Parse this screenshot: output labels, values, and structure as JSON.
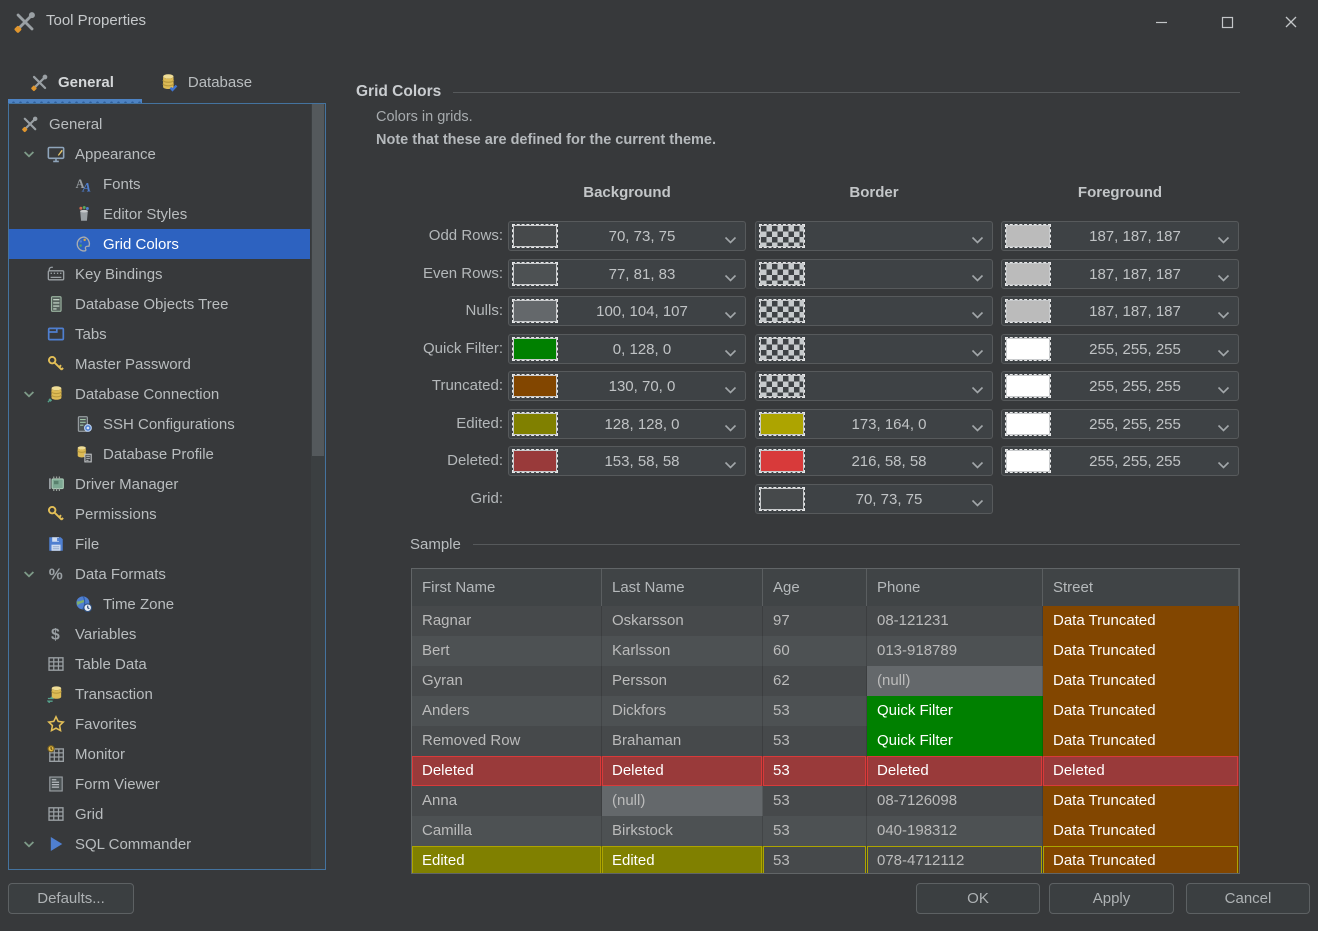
{
  "window": {
    "title": "Tool Properties",
    "controls": [
      {
        "name": "minimize-button",
        "icon": "minimize-icon"
      },
      {
        "name": "maximize-button",
        "icon": "maximize-icon"
      },
      {
        "name": "close-button",
        "icon": "close-icon"
      }
    ]
  },
  "tabs": [
    {
      "label": "General",
      "icon": "tools-icon",
      "selected": true
    },
    {
      "label": "Database",
      "icon": "database-check-icon",
      "selected": false
    }
  ],
  "sidebar": {
    "items": [
      {
        "label": "General",
        "icon": "tools-icon",
        "depth": 0
      },
      {
        "label": "Appearance",
        "icon": "appearance-icon",
        "depth": 1,
        "expanded": true
      },
      {
        "label": "Fonts",
        "icon": "fonts-icon",
        "depth": 2
      },
      {
        "label": "Editor Styles",
        "icon": "editor-styles-icon",
        "depth": 2
      },
      {
        "label": "Grid Colors",
        "icon": "grid-colors-icon",
        "depth": 2,
        "selected": true
      },
      {
        "label": "Key Bindings",
        "icon": "keyboard-icon",
        "depth": 1
      },
      {
        "label": "Database Objects Tree",
        "icon": "server-tree-icon",
        "depth": 1
      },
      {
        "label": "Tabs",
        "icon": "tabs-icon",
        "depth": 1
      },
      {
        "label": "Master Password",
        "icon": "key-icon",
        "depth": 1
      },
      {
        "label": "Database Connection",
        "icon": "database-connection-icon",
        "depth": 1,
        "expanded": true
      },
      {
        "label": "SSH Configurations",
        "icon": "ssh-icon",
        "depth": 2
      },
      {
        "label": "Database Profile",
        "icon": "database-profile-icon",
        "depth": 2
      },
      {
        "label": "Driver Manager",
        "icon": "driver-icon",
        "depth": 1
      },
      {
        "label": "Permissions",
        "icon": "key-icon",
        "depth": 1
      },
      {
        "label": "File",
        "icon": "floppy-icon",
        "depth": 1
      },
      {
        "label": "Data Formats",
        "icon": "percent-icon",
        "depth": 1,
        "expanded": true
      },
      {
        "label": "Time Zone",
        "icon": "timezone-icon",
        "depth": 2
      },
      {
        "label": "Variables",
        "icon": "dollar-icon",
        "depth": 1
      },
      {
        "label": "Table Data",
        "icon": "table-icon",
        "depth": 1
      },
      {
        "label": "Transaction",
        "icon": "transaction-icon",
        "depth": 1
      },
      {
        "label": "Favorites",
        "icon": "star-icon",
        "depth": 1
      },
      {
        "label": "Monitor",
        "icon": "monitor-icon",
        "depth": 1
      },
      {
        "label": "Form Viewer",
        "icon": "form-icon",
        "depth": 1
      },
      {
        "label": "Grid",
        "icon": "table-icon",
        "depth": 1
      },
      {
        "label": "SQL Commander",
        "icon": "play-icon",
        "depth": 1,
        "expanded": true
      }
    ]
  },
  "panel": {
    "title": "Grid Colors",
    "description": "Colors in grids.",
    "note": "Note that these are defined for the current theme.",
    "columns": [
      "Background",
      "Border",
      "Foreground"
    ],
    "rows": [
      {
        "label": "Odd Rows:",
        "background": {
          "color": "#46494B",
          "value": "70, 73, 75"
        },
        "border": {
          "transparent": true
        },
        "foreground": {
          "color": "#BBBBBB",
          "value": "187, 187, 187"
        }
      },
      {
        "label": "Even Rows:",
        "background": {
          "color": "#4D5153",
          "value": "77, 81, 83"
        },
        "border": {
          "transparent": true
        },
        "foreground": {
          "color": "#BBBBBB",
          "value": "187, 187, 187"
        }
      },
      {
        "label": "Nulls:",
        "background": {
          "color": "#64686B",
          "value": "100, 104, 107"
        },
        "border": {
          "transparent": true
        },
        "foreground": {
          "color": "#BBBBBB",
          "value": "187, 187, 187"
        }
      },
      {
        "label": "Quick Filter:",
        "background": {
          "color": "#008000",
          "value": "0, 128, 0"
        },
        "border": {
          "transparent": true
        },
        "foreground": {
          "color": "#FFFFFF",
          "value": "255, 255, 255"
        }
      },
      {
        "label": "Truncated:",
        "background": {
          "color": "#824600",
          "value": "130, 70, 0"
        },
        "border": {
          "transparent": true
        },
        "foreground": {
          "color": "#FFFFFF",
          "value": "255, 255, 255"
        }
      },
      {
        "label": "Edited:",
        "background": {
          "color": "#808000",
          "value": "128, 128, 0"
        },
        "border": {
          "color": "#ADA400",
          "value": "173, 164, 0"
        },
        "foreground": {
          "color": "#FFFFFF",
          "value": "255, 255, 255"
        }
      },
      {
        "label": "Deleted:",
        "background": {
          "color": "#993A3A",
          "value": "153, 58, 58"
        },
        "border": {
          "color": "#D83A3A",
          "value": "216, 58, 58"
        },
        "foreground": {
          "color": "#FFFFFF",
          "value": "255, 255, 255"
        }
      },
      {
        "label": "Grid:",
        "border": {
          "color": "#46494B",
          "value": "70, 73, 75"
        }
      }
    ]
  },
  "sample": {
    "title": "Sample",
    "table_columns": [
      "First Name",
      "Last Name",
      "Age",
      "Phone",
      "Street"
    ],
    "cell_colors": {
      "odd": "#46494B",
      "even": "#4D5153",
      "nulls": "#64686B",
      "quick_filter": "#008000",
      "truncated": "#824600",
      "edited": "#808000",
      "edited_border": "#ADA400",
      "deleted": "#993A3A",
      "deleted_border": "#D83A3A",
      "default_text": "#BBBBBB",
      "white_text": "#FFFFFF"
    },
    "table_rows": [
      {
        "stripe": "odd",
        "cells": [
          {
            "text": "Ragnar"
          },
          {
            "text": "Oskarsson"
          },
          {
            "text": "97"
          },
          {
            "text": "08-121231"
          },
          {
            "text": "Data Truncated",
            "bg": "truncated",
            "fg": "white"
          }
        ]
      },
      {
        "stripe": "even",
        "cells": [
          {
            "text": "Bert"
          },
          {
            "text": "Karlsson"
          },
          {
            "text": "60"
          },
          {
            "text": "013-918789"
          },
          {
            "text": "Data Truncated",
            "bg": "truncated",
            "fg": "white"
          }
        ]
      },
      {
        "stripe": "odd",
        "cells": [
          {
            "text": "Gyran"
          },
          {
            "text": "Persson"
          },
          {
            "text": "62"
          },
          {
            "text": "(null)",
            "bg": "nulls"
          },
          {
            "text": "Data Truncated",
            "bg": "truncated",
            "fg": "white"
          }
        ]
      },
      {
        "stripe": "even",
        "cells": [
          {
            "text": "Anders"
          },
          {
            "text": "Dickfors"
          },
          {
            "text": "53"
          },
          {
            "text": "Quick Filter",
            "bg": "quick_filter",
            "fg": "white"
          },
          {
            "text": "Data Truncated",
            "bg": "truncated",
            "fg": "white"
          }
        ]
      },
      {
        "stripe": "odd",
        "cells": [
          {
            "text": "Removed Row"
          },
          {
            "text": "Brahaman"
          },
          {
            "text": "53"
          },
          {
            "text": "Quick Filter",
            "bg": "quick_filter",
            "fg": "white"
          },
          {
            "text": "Data Truncated",
            "bg": "truncated",
            "fg": "white"
          }
        ]
      },
      {
        "stripe": "even",
        "cells": [
          {
            "text": "Deleted",
            "bg": "deleted",
            "border": "deleted_border",
            "fg": "white"
          },
          {
            "text": "Deleted",
            "bg": "deleted",
            "border": "deleted_border",
            "fg": "white"
          },
          {
            "text": "53",
            "bg": "deleted",
            "border": "deleted_border",
            "fg": "white"
          },
          {
            "text": "Deleted",
            "bg": "deleted",
            "border": "deleted_border",
            "fg": "white"
          },
          {
            "text": "Deleted",
            "bg": "deleted",
            "border": "deleted_border",
            "fg": "white"
          }
        ]
      },
      {
        "stripe": "odd",
        "cells": [
          {
            "text": "Anna"
          },
          {
            "text": "(null)",
            "bg": "nulls"
          },
          {
            "text": "53"
          },
          {
            "text": "08-7126098"
          },
          {
            "text": "Data Truncated",
            "bg": "truncated",
            "fg": "white"
          }
        ]
      },
      {
        "stripe": "even",
        "cells": [
          {
            "text": "Camilla"
          },
          {
            "text": "Birkstock"
          },
          {
            "text": "53"
          },
          {
            "text": "040-198312"
          },
          {
            "text": "Data Truncated",
            "bg": "truncated",
            "fg": "white"
          }
        ]
      },
      {
        "stripe": "odd",
        "cells": [
          {
            "text": "Edited",
            "bg": "edited",
            "border": "edited_border",
            "fg": "white"
          },
          {
            "text": "Edited",
            "bg": "edited",
            "border": "edited_border",
            "fg": "white"
          },
          {
            "text": "53",
            "border": "edited_border"
          },
          {
            "text": "078-4712112",
            "border": "edited_border"
          },
          {
            "text": "Data Truncated",
            "bg": "truncated",
            "border": "edited_border",
            "fg": "white"
          }
        ]
      }
    ]
  },
  "footer": {
    "defaults_label": "Defaults...",
    "ok_label": "OK",
    "apply_label": "Apply",
    "cancel_label": "Cancel"
  },
  "theme": {
    "window_bg": "#37393B",
    "selection_blue": "#2D62C0",
    "panel_border_blue": "#44739F",
    "tab_underline_blue": "#4D83C4"
  }
}
